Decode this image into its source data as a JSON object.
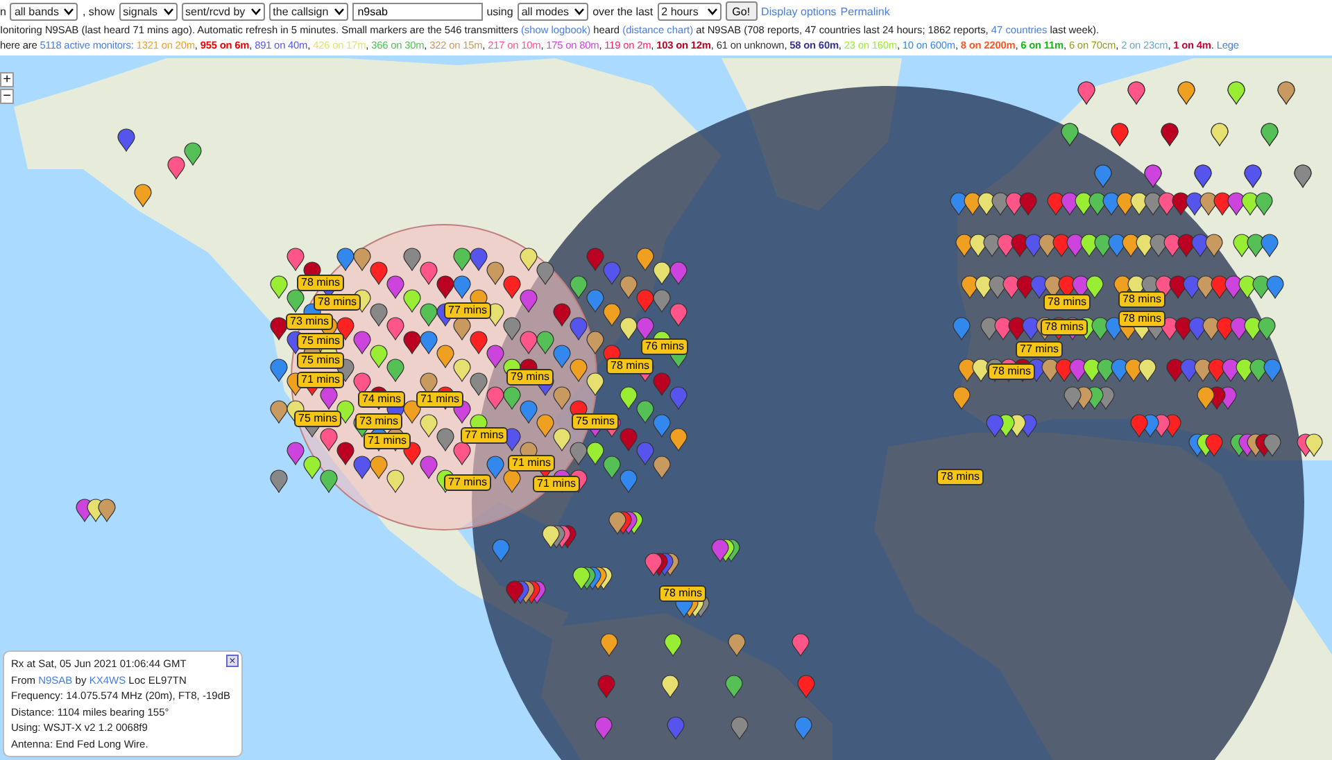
{
  "controls": {
    "prefix": "n",
    "band_select": "all bands",
    "show_label": ", show",
    "what_select": "signals",
    "direction_select": "sent/rcvd by",
    "target_select": "the callsign",
    "callsign_input": "n9sab",
    "using_label": "using",
    "mode_select": "all modes",
    "over_label": "over the last",
    "period_select": "2 hours",
    "go_button": "Go!",
    "links": [
      "Display options",
      "Permalink"
    ]
  },
  "status_line": [
    {
      "text": "Ionitoring N9SAB (last heard 71 mins ago). Automatic refresh in 5 minutes. Small markers are the 546 transmitters",
      "kind": "text"
    },
    {
      "text": "(show logbook)",
      "kind": "link"
    },
    {
      "text": "heard",
      "kind": "text"
    },
    {
      "text": "(distance chart)",
      "kind": "link"
    },
    {
      "text": "at N9SAB (708 reports, 47 countries last 24 hours; 1862 reports,",
      "kind": "text"
    },
    {
      "text": "47 countries",
      "kind": "link"
    },
    {
      "text": "last week).",
      "kind": "text"
    }
  ],
  "monitors_line": {
    "prefix": "here are",
    "total": "5118 active monitors:",
    "separator": ",",
    "end": ".",
    "legend": "Lege",
    "bands": [
      {
        "label": "1321 on 20m",
        "color": "#f0a020",
        "bold": false
      },
      {
        "label": "955 on 6m",
        "color": "#ee0000",
        "bold": true
      },
      {
        "label": "891 on 40m",
        "color": "#5555ee",
        "bold": false
      },
      {
        "label": "426 on 17m",
        "color": "#e6e070",
        "bold": false
      },
      {
        "label": "366 on 30m",
        "color": "#55c055",
        "bold": false
      },
      {
        "label": "322 on 15m",
        "color": "#c89a60",
        "bold": false
      },
      {
        "label": "217 on 10m",
        "color": "#ff5588",
        "bold": false
      },
      {
        "label": "175 on 80m",
        "color": "#cc44dd",
        "bold": false
      },
      {
        "label": "119 on 2m",
        "color": "#ff2266",
        "bold": false
      },
      {
        "label": "103 on 12m",
        "color": "#bb0022",
        "bold": true
      },
      {
        "label": "61 on unknown",
        "color": "#333333",
        "bold": false
      },
      {
        "label": "58 on 60m",
        "color": "#333399",
        "bold": true
      },
      {
        "label": "23 on 160m",
        "color": "#99ee33",
        "bold": false
      },
      {
        "label": "10 on 600m",
        "color": "#3388ee",
        "bold": false
      },
      {
        "label": "8 on 2200m",
        "color": "#ff5522",
        "bold": true
      },
      {
        "label": "6 on 11m",
        "color": "#11bb11",
        "bold": true
      },
      {
        "label": "6 on 70cm",
        "color": "#999922",
        "bold": false
      },
      {
        "label": "2 on 23cm",
        "color": "#66aacc",
        "bold": false
      },
      {
        "label": "1 on 4m",
        "color": "#cc0033",
        "bold": true
      }
    ]
  },
  "map": {
    "zoom_in": "+",
    "zoom_out": "−",
    "time_tags": [
      "78 mins",
      "78 mins",
      "77 mins",
      "73 mins",
      "75 mins",
      "75 mins",
      "71 mins",
      "79 mins",
      "78 mins",
      "76 mins",
      "74 mins",
      "71 mins",
      "75 mins",
      "73 mins",
      "71 mins",
      "77 mins",
      "75 mins",
      "71 mins",
      "71 mins",
      "77 mins",
      "78 mins",
      "78 mins",
      "78 mins",
      "78 mins",
      "78 mins",
      "77 mins",
      "78 mins",
      "78 mins"
    ]
  },
  "popup": {
    "lines": [
      [
        {
          "text": "Rx at Sat, 05 Jun 2021 01:06:44 GMT",
          "kind": "text"
        }
      ],
      [
        {
          "text": "From",
          "kind": "text"
        },
        {
          "text": "N9SAB",
          "kind": "link"
        },
        {
          "text": "by",
          "kind": "text"
        },
        {
          "text": "KX4WS",
          "kind": "link"
        },
        {
          "text": "Loc EL97TN",
          "kind": "text"
        }
      ],
      [
        {
          "text": "Frequency: 14.075.574 MHz (20m), FT8, -19dB",
          "kind": "text"
        }
      ],
      [
        {
          "text": "Distance: 1104 miles bearing 155°",
          "kind": "text"
        }
      ],
      [
        {
          "text": "Using: WSJT-X v2 1.2 0068f9",
          "kind": "text"
        }
      ],
      [
        {
          "text": "Antenna: End Fed Long Wire.",
          "kind": "text"
        }
      ]
    ],
    "close": "×"
  }
}
